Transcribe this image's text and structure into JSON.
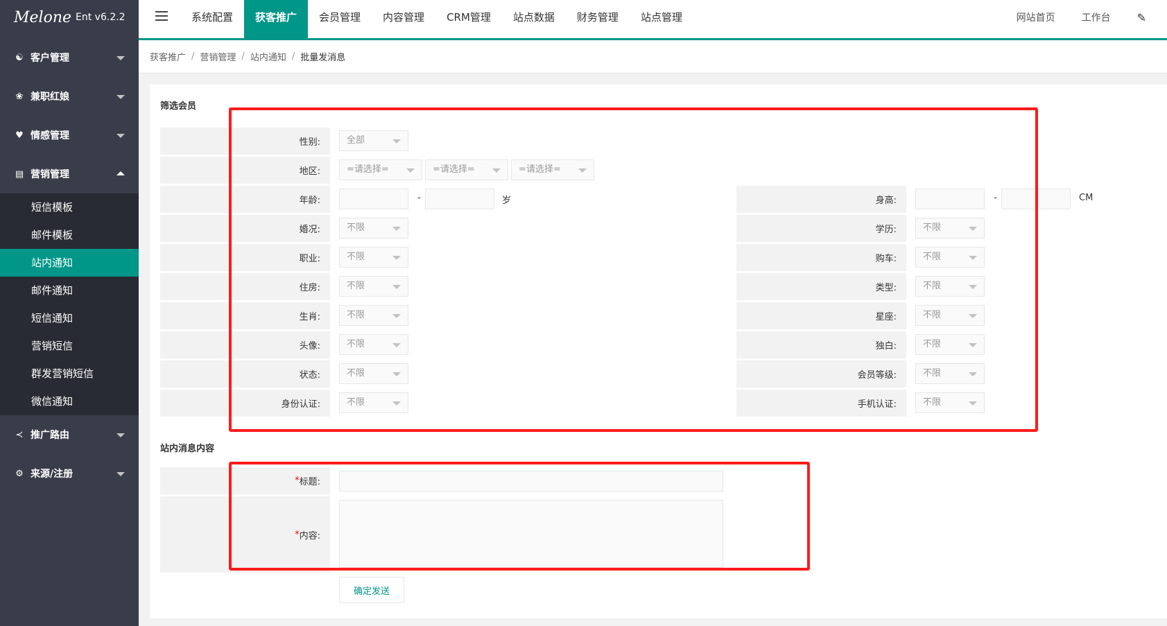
{
  "brand": {
    "logo_text": "Melone",
    "version": "Ent v6.2.2"
  },
  "topbar": {
    "nav": [
      "系统配置",
      "获客推广",
      "会员管理",
      "内容管理",
      "CRM管理",
      "站点数据",
      "财务管理",
      "站点管理"
    ],
    "active_nav": "获客推广",
    "right": {
      "home": "网站首页",
      "workbench": "工作台"
    }
  },
  "sidebar": {
    "groups": [
      {
        "label": "客户管理",
        "icon": "users-icon"
      },
      {
        "label": "兼职红娘",
        "icon": "badge-icon"
      },
      {
        "label": "情感管理",
        "icon": "heart-icon"
      },
      {
        "label": "营销管理",
        "icon": "chart-icon",
        "expanded": true
      },
      {
        "label": "推广路由",
        "icon": "share-icon"
      },
      {
        "label": "来源/注册",
        "icon": "source-icon"
      }
    ],
    "marketing_items": [
      "短信模板",
      "邮件模板",
      "站内通知",
      "邮件通知",
      "短信通知",
      "营销短信",
      "群发营销短信",
      "微信通知"
    ],
    "active_item": "站内通知"
  },
  "breadcrumb": [
    "获客推广",
    "营销管理",
    "站内通知",
    "批量发消息"
  ],
  "filter": {
    "section_title": "筛选会员",
    "gender": {
      "label": "性别:",
      "value": "全部"
    },
    "region": {
      "label": "地区:",
      "placeholders": [
        "=请选择=",
        "=请选择=",
        "=请选择="
      ]
    },
    "age": {
      "label": "年龄:",
      "dash": "-",
      "unit": "岁"
    },
    "height": {
      "label": "身高:",
      "dash": "-",
      "unit": "CM"
    },
    "left_fields": [
      {
        "label": "婚况:",
        "value": "不限"
      },
      {
        "label": "职业:",
        "value": "不限"
      },
      {
        "label": "住房:",
        "value": "不限"
      },
      {
        "label": "生肖:",
        "value": "不限"
      },
      {
        "label": "头像:",
        "value": "不限"
      },
      {
        "label": "状态:",
        "value": "不限"
      },
      {
        "label": "身份认证:",
        "value": "不限"
      }
    ],
    "right_fields": [
      {
        "label": "学历:",
        "value": "不限"
      },
      {
        "label": "购车:",
        "value": "不限"
      },
      {
        "label": "类型:",
        "value": "不限"
      },
      {
        "label": "星座:",
        "value": "不限"
      },
      {
        "label": "独白:",
        "value": "不限"
      },
      {
        "label": "会员等级:",
        "value": "不限"
      },
      {
        "label": "手机认证:",
        "value": "不限"
      }
    ]
  },
  "message": {
    "section_title": "站内消息内容",
    "required_mark": "*",
    "title_label": "标题:",
    "content_label": "内容:",
    "submit": "确定发送"
  },
  "colors": {
    "accent": "#009688",
    "sidebar": "#393d49",
    "highlight": "#ff1a1a"
  }
}
